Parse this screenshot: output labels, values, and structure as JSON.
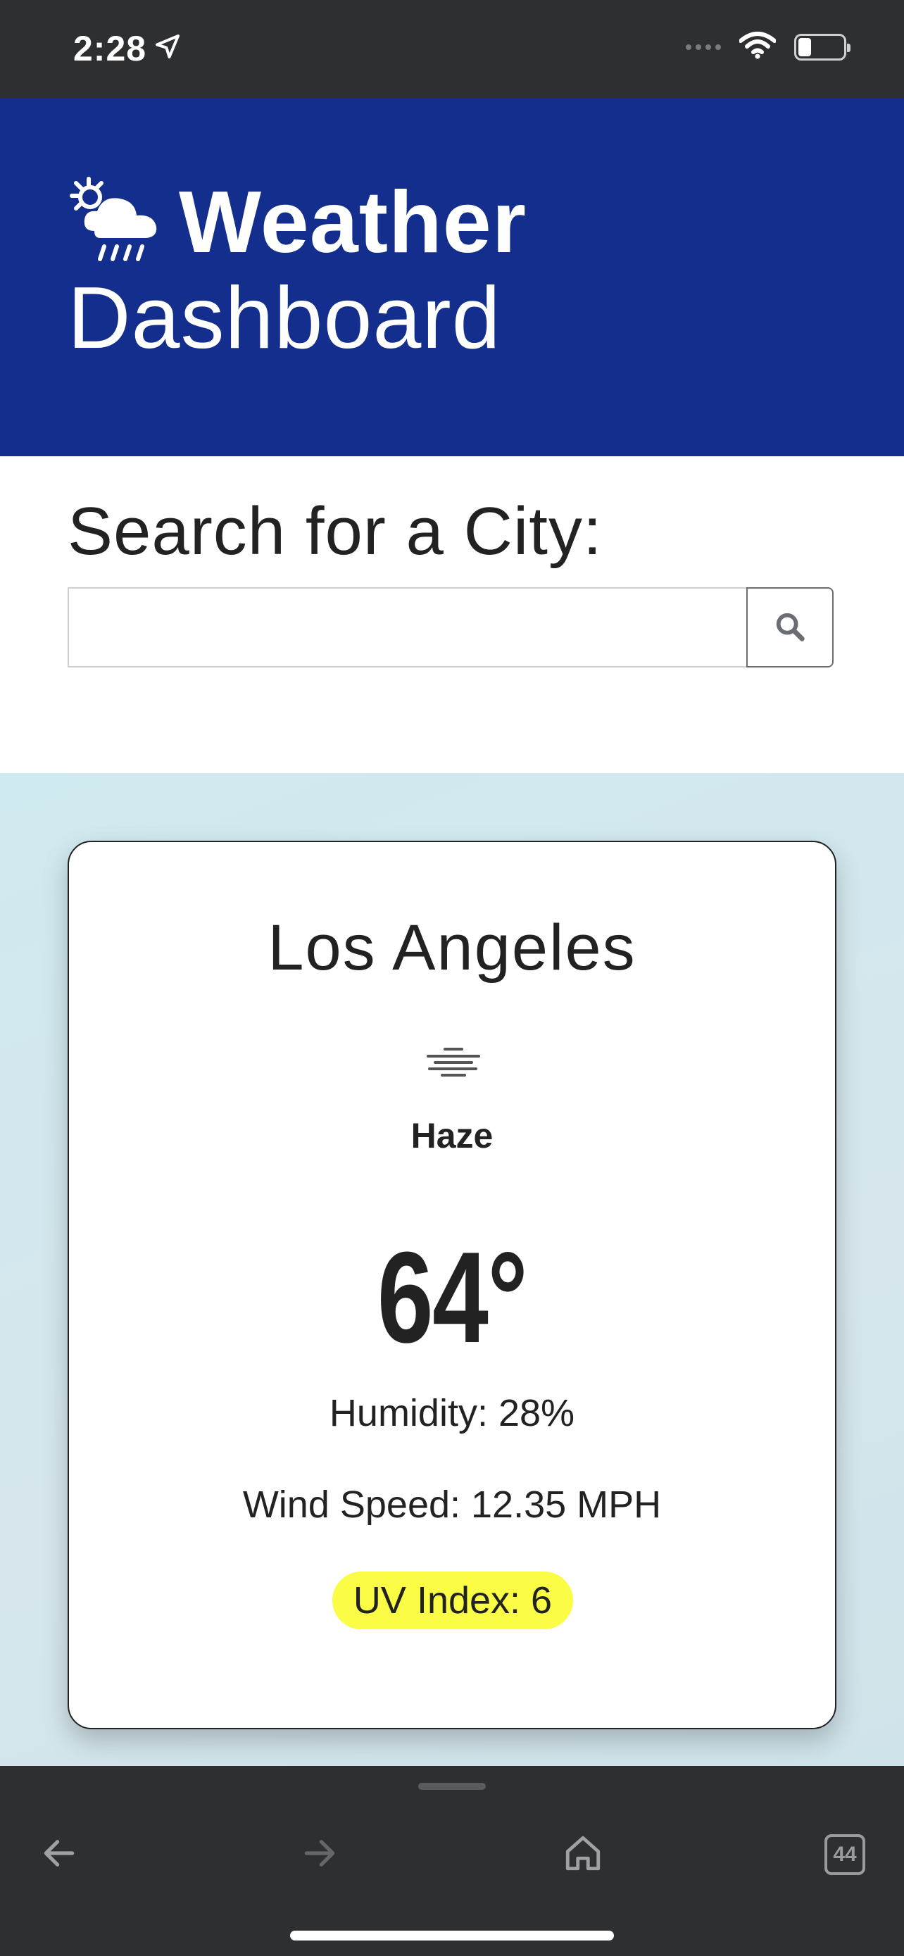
{
  "status_bar": {
    "time": "2:28",
    "location_icon": "location-arrow-icon",
    "signal_icon": "cellular-dots-icon",
    "wifi_icon": "wifi-icon",
    "battery_icon": "battery-low-icon"
  },
  "header": {
    "logo_icon": "sun-cloud-rain-icon",
    "title_bold": "Weather",
    "title_light": "Dashboard",
    "background_color": "#132e8c"
  },
  "search": {
    "label": "Search for a City:",
    "value": "",
    "placeholder": "",
    "button_icon": "search-icon"
  },
  "current_weather": {
    "city": "Los Angeles",
    "condition_icon": "haze-icon",
    "condition": "Haze",
    "temperature": "64°",
    "humidity": "Humidity: 28%",
    "wind_speed": "Wind Speed: 12.35 MPH",
    "uv_index": "UV Index: 6",
    "uv_color": "#fafc46"
  },
  "browser_toolbar": {
    "back_icon": "arrow-left-icon",
    "forward_icon": "arrow-right-icon",
    "home_icon": "home-icon",
    "tabs_count": "44"
  }
}
